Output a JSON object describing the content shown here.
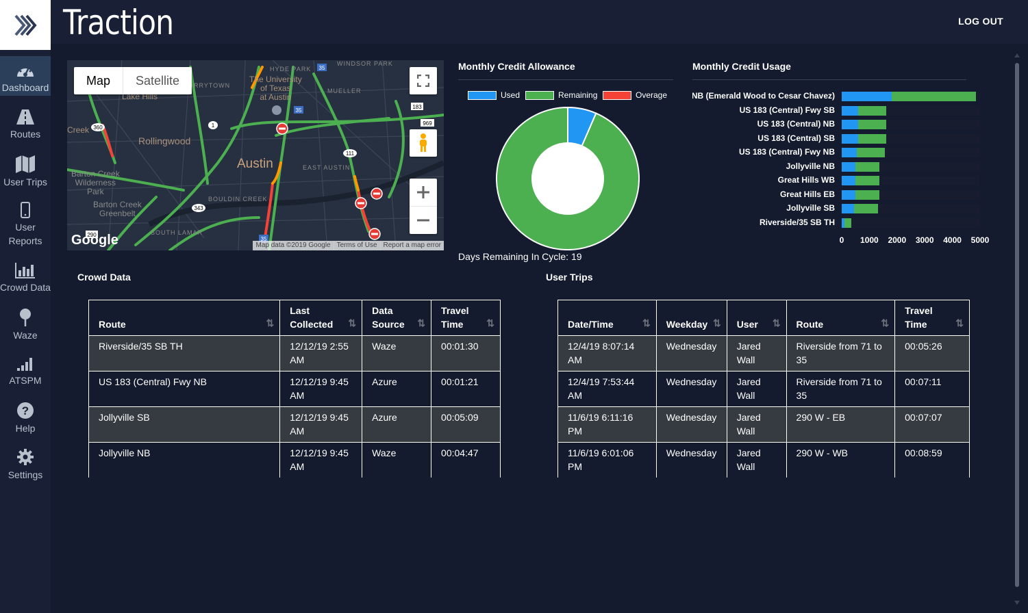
{
  "app": {
    "title": "Traction",
    "logout_label": "LOG OUT"
  },
  "sidebar": {
    "items": [
      {
        "label": "Dashboard",
        "icon": "dashboard-gauge-icon",
        "active": true
      },
      {
        "label": "Routes",
        "icon": "road-icon"
      },
      {
        "label": "User Trips",
        "icon": "map-icon"
      },
      {
        "label": "User Reports",
        "icon": "mobile-phone-icon"
      },
      {
        "label": "Crowd Data",
        "icon": "bar-chart-icon"
      },
      {
        "label": "Waze",
        "icon": "map-pin-icon"
      },
      {
        "label": "ATSPM",
        "icon": "signal-bars-icon"
      },
      {
        "label": "Help",
        "icon": "help-circle-icon"
      },
      {
        "label": "Settings",
        "icon": "gear-icon"
      }
    ]
  },
  "map": {
    "type_map": "Map",
    "type_satellite": "Satellite",
    "labels": {
      "hyde_park": "HYDE PARK",
      "windsor_park": "WINDSOR PARK",
      "university": "The University",
      "university2": "of Texas",
      "university3": "at Austin",
      "mueller": "MUELLER",
      "tarrytown": "ARRYTOWN",
      "lake_hills": "Lake Hills",
      "creek": "Creek",
      "rollingwood": "Rollingwood",
      "austin": "Austin",
      "east_austin": "EAST AUSTIN",
      "barton_creek_wilderness": "Barton Creek",
      "barton_creek_wilderness2": "Wilderness",
      "barton_creek_wilderness3": "Park",
      "bouldin_creek": "BOULDIN CREEK",
      "barton_creek_greenbelt": "Barton Creek",
      "barton_creek_greenbelt2": "Greenbelt",
      "south_lamar": "SOUTH LAMAR",
      "google": "Google"
    },
    "shields": [
      "35",
      "35",
      "183",
      "969",
      "111",
      "360",
      "343",
      "290",
      "1",
      "35"
    ],
    "attribution": [
      "Map data ©2019 Google",
      "Terms of Use",
      "Report a map error"
    ]
  },
  "credit_allowance": {
    "title": "Monthly Credit Allowance",
    "days_remaining_label": "Days Remaining In Cycle: 19",
    "chart_data": {
      "type": "pie",
      "variant": "donut",
      "categories": [
        "Used",
        "Remaining",
        "Overage"
      ],
      "values": [
        6.5,
        93.5,
        0
      ],
      "colors": [
        "#2196f3",
        "#4caf50",
        "#f44336"
      ],
      "legend": "top"
    }
  },
  "credit_usage": {
    "title": "Monthly Credit Usage",
    "chart_data": {
      "type": "bar",
      "orientation": "horizontal",
      "stacked": true,
      "categories": [
        "t NB (Emerald Wood to Cesar Chavez)",
        "US 183 (Central) Fwy SB",
        "US 183 (Central) NB",
        "US 183 (Central) SB",
        "US 183 (Central) Fwy NB",
        "Jollyville NB",
        "Great Hills WB",
        "Great Hills EB",
        "Jollyville SB",
        "Riverside/35 SB TH"
      ],
      "series": [
        {
          "name": "Used",
          "color": "#2196f3",
          "values": [
            1800,
            600,
            600,
            600,
            550,
            500,
            500,
            500,
            450,
            100
          ]
        },
        {
          "name": "Remaining",
          "color": "#4caf50",
          "values": [
            3050,
            1000,
            1000,
            1000,
            1000,
            850,
            850,
            850,
            850,
            250
          ]
        }
      ],
      "xlim": [
        0,
        5000
      ],
      "ticks": [
        "0",
        "1000",
        "2000",
        "3000",
        "4000",
        "5000"
      ]
    }
  },
  "crowd_data": {
    "title": "Crowd Data",
    "columns": [
      "Route",
      "Last Collected",
      "Data Source",
      "Travel Time"
    ],
    "rows": [
      [
        "Riverside/35 SB TH",
        "12/12/19 2:55 AM",
        "Waze",
        "00:01:30"
      ],
      [
        "US 183 (Central) Fwy NB",
        "12/12/19 9:45 AM",
        "Azure",
        "00:01:21"
      ],
      [
        "Jollyville SB",
        "12/12/19 9:45 AM",
        "Azure",
        "00:05:09"
      ],
      [
        "Jollyville NB",
        "12/12/19 9:45 AM",
        "Waze",
        "00:04:47"
      ]
    ]
  },
  "user_trips": {
    "title": "User Trips",
    "columns": [
      "Date/Time",
      "Weekday",
      "User",
      "Route",
      "Travel Time"
    ],
    "rows": [
      [
        "12/4/19 8:07:14 AM",
        "Wednesday",
        "Jared Wall",
        "Riverside from 71 to 35",
        "00:05:26"
      ],
      [
        "12/4/19 7:53:44 AM",
        "Wednesday",
        "Jared Wall",
        "Riverside from 71 to 35",
        "00:07:11"
      ],
      [
        "11/6/19 6:11:16 PM",
        "Wednesday",
        "Jared Wall",
        "290 W - EB",
        "00:07:07"
      ],
      [
        "11/6/19 6:01:06 PM",
        "Wednesday",
        "Jared Wall",
        "290 W - WB",
        "00:08:59"
      ]
    ]
  }
}
